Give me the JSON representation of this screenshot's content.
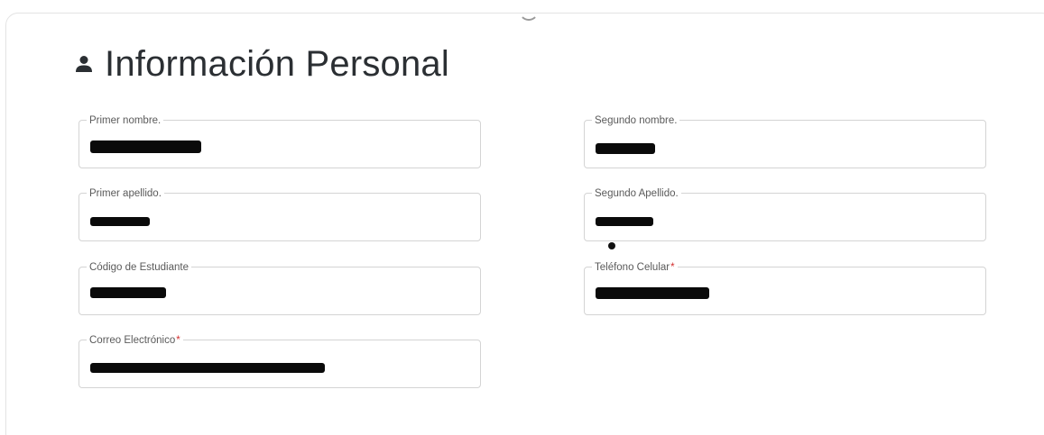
{
  "section": {
    "title": "Información Personal",
    "icon": "person-icon"
  },
  "fields": {
    "primer_nombre": {
      "label": "Primer nombre.",
      "required": false,
      "value": "",
      "redacted": true
    },
    "segundo_nombre": {
      "label": "Segundo nombre.",
      "required": false,
      "value": "",
      "redacted": true
    },
    "primer_apellido": {
      "label": "Primer apellido.",
      "required": false,
      "value": "",
      "redacted": true
    },
    "segundo_apellido": {
      "label": "Segundo Apellido.",
      "required": false,
      "value": "",
      "redacted": true
    },
    "codigo_estudiante": {
      "label": "Código de Estudiante",
      "required": false,
      "value": "",
      "redacted": true
    },
    "telefono_celular": {
      "label": "Teléfono Celular",
      "required": true,
      "value": "",
      "redacted": true
    },
    "correo_electronico": {
      "label": "Correo Electrónico",
      "required": true,
      "value": "",
      "redacted": true
    }
  },
  "required_marker": "*",
  "colors": {
    "title_text": "#2b2f33",
    "label_text": "#5a5a5a",
    "required_marker": "#d32f2f",
    "field_border": "#d4d4d4",
    "redaction": "#0a0a0a"
  }
}
